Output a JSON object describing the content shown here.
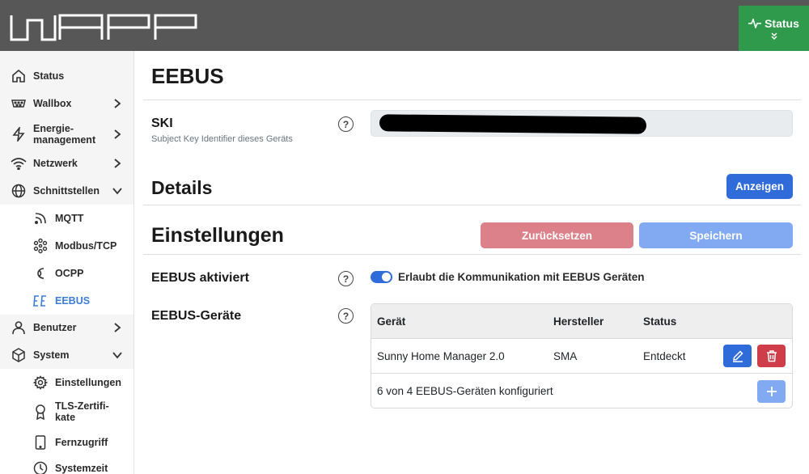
{
  "header": {
    "logo_text": "WARP",
    "status_button": "Status",
    "colors": {
      "bar": "#575757",
      "status": "#2f9a4b"
    }
  },
  "sidebar": {
    "items": [
      {
        "label": "Status",
        "icon": "home-icon"
      },
      {
        "label": "Wallbox",
        "icon": "charger-icon"
      },
      {
        "label": "Energie-\nmanagement",
        "icon": "lightning-icon"
      },
      {
        "label": "Netzwerk",
        "icon": "wifi-icon"
      },
      {
        "label": "Schnittstellen",
        "icon": "globe-icon"
      },
      {
        "label": "Benutzer",
        "icon": "user-icon"
      },
      {
        "label": "System",
        "icon": "box-icon"
      }
    ],
    "interfaces_sub": [
      {
        "label": "MQTT",
        "icon": "rss-icon"
      },
      {
        "label": "Modbus/TCP",
        "icon": "atom-icon"
      },
      {
        "label": "OCPP",
        "icon": "ocpp-icon"
      },
      {
        "label": "EEBUS",
        "icon": "eebus-icon"
      }
    ],
    "system_sub": [
      {
        "label": "Einstellungen",
        "icon": "gear-icon"
      },
      {
        "label": "TLS-Zertifi-\nkate",
        "icon": "certificate-icon"
      },
      {
        "label": "Fernzugriff",
        "icon": "tablet-icon"
      },
      {
        "label": "Systemzeit",
        "icon": "clock-icon"
      }
    ]
  },
  "main": {
    "title": "EEBUS",
    "ski": {
      "label": "SKI",
      "description": "Subject Key Identifier dieses Geräts"
    },
    "details": {
      "title": "Details",
      "show_button": "Anzeigen"
    },
    "settings": {
      "title": "Einstellungen",
      "reset_button": "Zurücksetzen",
      "save_button": "Speichern"
    },
    "eebus_enabled": {
      "label": "EEBUS aktiviert",
      "toggle_text": "Erlaubt die Kommunikation mit EEBUS Geräten",
      "checked": true
    },
    "devices": {
      "label": "EEBUS-Geräte",
      "columns": [
        "Gerät",
        "Hersteller",
        "Status"
      ],
      "rows": [
        {
          "device": "Sunny Home Manager 2.0",
          "manufacturer": "SMA",
          "status": "Entdeckt"
        }
      ],
      "footer": "6 von 4 EEBUS-Geräten konfiguriert"
    },
    "colors": {
      "primary": "#2f6bd9",
      "danger": "#cf3e48",
      "active_nav": "#3b7dd8"
    }
  }
}
